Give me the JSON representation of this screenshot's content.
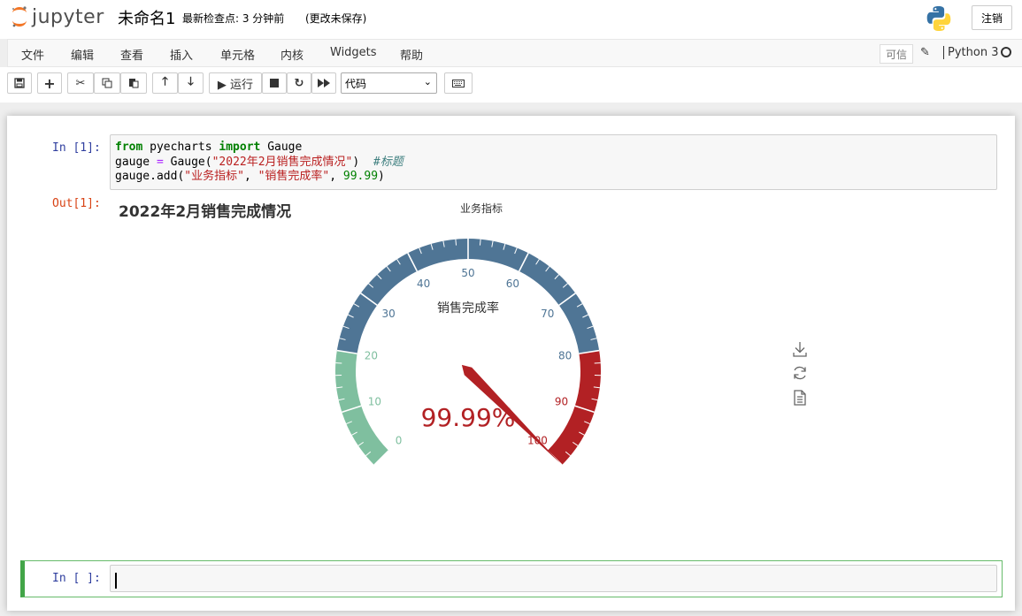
{
  "header": {
    "logo_text": "jupyter",
    "notebook_name": "未命名1",
    "checkpoint": "最新检查点: 3 分钟前",
    "autosave": "(更改未保存)",
    "logout": "注销"
  },
  "menu": [
    "文件",
    "编辑",
    "查看",
    "插入",
    "单元格",
    "内核",
    "Widgets",
    "帮助"
  ],
  "kernel": {
    "trusted": "可信",
    "name": "Python 3"
  },
  "toolbar": {
    "run_label": "▶ 运行",
    "cell_type": "代码",
    "icons": [
      "save-icon",
      "plus-icon",
      "cut-icon",
      "copy-icon",
      "paste-icon",
      "arrow-up-icon",
      "arrow-down-icon",
      "run-icon",
      "stop-icon",
      "restart-icon",
      "fast-forward-icon",
      "keyboard-icon"
    ]
  },
  "cells": {
    "cell1_prompt": "In [1]:",
    "out_prompt": "Out[1]:",
    "code": {
      "l1_kw1": "from",
      "l1_mod": " pyecharts ",
      "l1_kw2": "import",
      "l1_name": " Gauge",
      "l2_a": "gauge ",
      "l2_op": "=",
      "l2_b": " Gauge(",
      "l2_str": "\"2022年2月销售完成情况\"",
      "l2_c": ")  ",
      "l2_cm": "#标题",
      "l3_a": "gauge.add(",
      "l3_s1": "\"业务指标\"",
      "l3_b": ", ",
      "l3_s2": "\"销售完成率\"",
      "l3_c": ", ",
      "l3_num": "99.99",
      "l3_d": ")"
    },
    "cell2_prompt": "In [ ]:"
  },
  "chart_data": {
    "type": "gauge",
    "title": "2022年2月销售完成情况",
    "legend": [
      "业务指标"
    ],
    "series_name": "业务指标",
    "gauge_label": "销售完成率",
    "value": 99.99,
    "value_text": "99.99%",
    "min": 0,
    "max": 100,
    "tick_labels": [
      "0",
      "10",
      "20",
      "30",
      "40",
      "50",
      "60",
      "70",
      "80",
      "90",
      "100"
    ],
    "color_bands": [
      {
        "to": 0.2,
        "color": "#7fbf9f"
      },
      {
        "to": 0.8,
        "color": "#4f7595"
      },
      {
        "to": 1.0,
        "color": "#b22124"
      }
    ],
    "toolbox": [
      "download-icon",
      "refresh-icon",
      "data-view-icon"
    ]
  }
}
